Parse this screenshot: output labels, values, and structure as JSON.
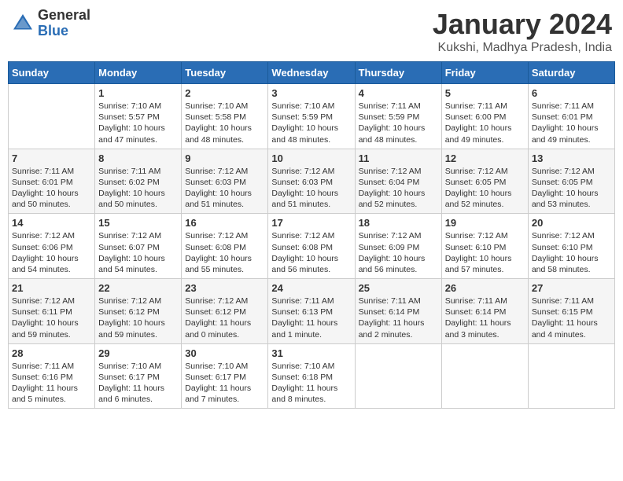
{
  "header": {
    "logo_general": "General",
    "logo_blue": "Blue",
    "month_title": "January 2024",
    "location": "Kukshi, Madhya Pradesh, India"
  },
  "days_of_week": [
    "Sunday",
    "Monday",
    "Tuesday",
    "Wednesday",
    "Thursday",
    "Friday",
    "Saturday"
  ],
  "weeks": [
    [
      {
        "num": "",
        "info": ""
      },
      {
        "num": "1",
        "info": "Sunrise: 7:10 AM\nSunset: 5:57 PM\nDaylight: 10 hours\nand 47 minutes."
      },
      {
        "num": "2",
        "info": "Sunrise: 7:10 AM\nSunset: 5:58 PM\nDaylight: 10 hours\nand 48 minutes."
      },
      {
        "num": "3",
        "info": "Sunrise: 7:10 AM\nSunset: 5:59 PM\nDaylight: 10 hours\nand 48 minutes."
      },
      {
        "num": "4",
        "info": "Sunrise: 7:11 AM\nSunset: 5:59 PM\nDaylight: 10 hours\nand 48 minutes."
      },
      {
        "num": "5",
        "info": "Sunrise: 7:11 AM\nSunset: 6:00 PM\nDaylight: 10 hours\nand 49 minutes."
      },
      {
        "num": "6",
        "info": "Sunrise: 7:11 AM\nSunset: 6:01 PM\nDaylight: 10 hours\nand 49 minutes."
      }
    ],
    [
      {
        "num": "7",
        "info": "Sunrise: 7:11 AM\nSunset: 6:01 PM\nDaylight: 10 hours\nand 50 minutes."
      },
      {
        "num": "8",
        "info": "Sunrise: 7:11 AM\nSunset: 6:02 PM\nDaylight: 10 hours\nand 50 minutes."
      },
      {
        "num": "9",
        "info": "Sunrise: 7:12 AM\nSunset: 6:03 PM\nDaylight: 10 hours\nand 51 minutes."
      },
      {
        "num": "10",
        "info": "Sunrise: 7:12 AM\nSunset: 6:03 PM\nDaylight: 10 hours\nand 51 minutes."
      },
      {
        "num": "11",
        "info": "Sunrise: 7:12 AM\nSunset: 6:04 PM\nDaylight: 10 hours\nand 52 minutes."
      },
      {
        "num": "12",
        "info": "Sunrise: 7:12 AM\nSunset: 6:05 PM\nDaylight: 10 hours\nand 52 minutes."
      },
      {
        "num": "13",
        "info": "Sunrise: 7:12 AM\nSunset: 6:05 PM\nDaylight: 10 hours\nand 53 minutes."
      }
    ],
    [
      {
        "num": "14",
        "info": "Sunrise: 7:12 AM\nSunset: 6:06 PM\nDaylight: 10 hours\nand 54 minutes."
      },
      {
        "num": "15",
        "info": "Sunrise: 7:12 AM\nSunset: 6:07 PM\nDaylight: 10 hours\nand 54 minutes."
      },
      {
        "num": "16",
        "info": "Sunrise: 7:12 AM\nSunset: 6:08 PM\nDaylight: 10 hours\nand 55 minutes."
      },
      {
        "num": "17",
        "info": "Sunrise: 7:12 AM\nSunset: 6:08 PM\nDaylight: 10 hours\nand 56 minutes."
      },
      {
        "num": "18",
        "info": "Sunrise: 7:12 AM\nSunset: 6:09 PM\nDaylight: 10 hours\nand 56 minutes."
      },
      {
        "num": "19",
        "info": "Sunrise: 7:12 AM\nSunset: 6:10 PM\nDaylight: 10 hours\nand 57 minutes."
      },
      {
        "num": "20",
        "info": "Sunrise: 7:12 AM\nSunset: 6:10 PM\nDaylight: 10 hours\nand 58 minutes."
      }
    ],
    [
      {
        "num": "21",
        "info": "Sunrise: 7:12 AM\nSunset: 6:11 PM\nDaylight: 10 hours\nand 59 minutes."
      },
      {
        "num": "22",
        "info": "Sunrise: 7:12 AM\nSunset: 6:12 PM\nDaylight: 10 hours\nand 59 minutes."
      },
      {
        "num": "23",
        "info": "Sunrise: 7:12 AM\nSunset: 6:12 PM\nDaylight: 11 hours\nand 0 minutes."
      },
      {
        "num": "24",
        "info": "Sunrise: 7:11 AM\nSunset: 6:13 PM\nDaylight: 11 hours\nand 1 minute."
      },
      {
        "num": "25",
        "info": "Sunrise: 7:11 AM\nSunset: 6:14 PM\nDaylight: 11 hours\nand 2 minutes."
      },
      {
        "num": "26",
        "info": "Sunrise: 7:11 AM\nSunset: 6:14 PM\nDaylight: 11 hours\nand 3 minutes."
      },
      {
        "num": "27",
        "info": "Sunrise: 7:11 AM\nSunset: 6:15 PM\nDaylight: 11 hours\nand 4 minutes."
      }
    ],
    [
      {
        "num": "28",
        "info": "Sunrise: 7:11 AM\nSunset: 6:16 PM\nDaylight: 11 hours\nand 5 minutes."
      },
      {
        "num": "29",
        "info": "Sunrise: 7:10 AM\nSunset: 6:17 PM\nDaylight: 11 hours\nand 6 minutes."
      },
      {
        "num": "30",
        "info": "Sunrise: 7:10 AM\nSunset: 6:17 PM\nDaylight: 11 hours\nand 7 minutes."
      },
      {
        "num": "31",
        "info": "Sunrise: 7:10 AM\nSunset: 6:18 PM\nDaylight: 11 hours\nand 8 minutes."
      },
      {
        "num": "",
        "info": ""
      },
      {
        "num": "",
        "info": ""
      },
      {
        "num": "",
        "info": ""
      }
    ]
  ]
}
